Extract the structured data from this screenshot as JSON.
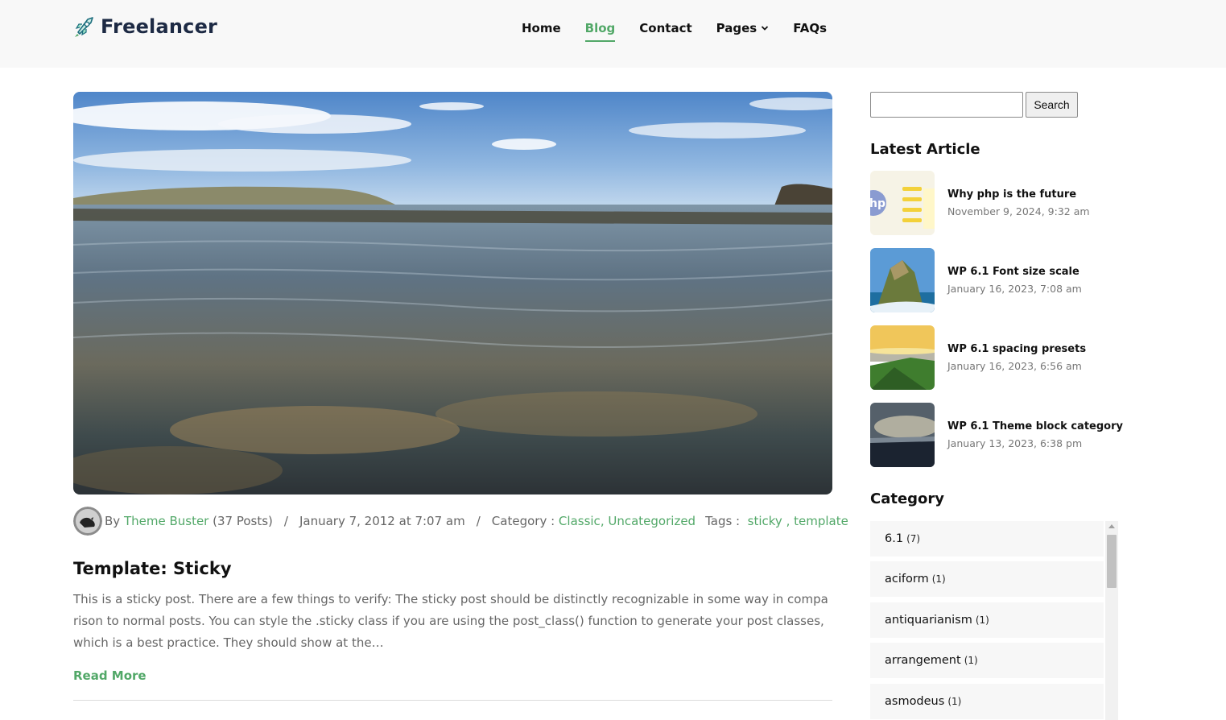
{
  "header": {
    "logo_text": "Freelancer",
    "nav": [
      {
        "label": "Home"
      },
      {
        "label": "Blog",
        "active": true
      },
      {
        "label": "Contact"
      },
      {
        "label": "Pages",
        "dropdown": true
      },
      {
        "label": "FAQs"
      }
    ]
  },
  "post": {
    "meta": {
      "by": "By",
      "author": "Theme Buster",
      "author_posts": "(37 Posts)",
      "sep": "/",
      "date": "January 7, 2012 at 7:07 am",
      "category_label": "Category :",
      "categories": [
        "Classic",
        "Uncategorized"
      ],
      "tags_label": "Tags :",
      "tags": [
        "sticky",
        "template"
      ]
    },
    "title": "Template: Sticky",
    "excerpt": "This is a sticky post. There are a few things to verify: The sticky post should be distinctly recognizable in some way in comparison to normal posts. You can style the .sticky class if you are using the post_class() function to generate your post classes, which is a best practice. They should show at the…",
    "read_more": "Read More"
  },
  "sidebar": {
    "search_button": "Search",
    "search_value": "",
    "latest_heading": "Latest Article",
    "articles": [
      {
        "title": "Why php is the future",
        "date": "November 9, 2024, 9:32 am"
      },
      {
        "title": "WP 6.1 Font size scale",
        "date": "January 16, 2023, 7:08 am"
      },
      {
        "title": "WP 6.1 spacing presets",
        "date": "January 16, 2023, 6:56 am"
      },
      {
        "title": "WP 6.1 Theme block category",
        "date": "January 13, 2023, 6:38 pm"
      }
    ],
    "category_heading": "Category",
    "categories": [
      {
        "name": "6.1",
        "count": "(7)"
      },
      {
        "name": "aciform",
        "count": "(1)"
      },
      {
        "name": "antiquarianism",
        "count": "(1)"
      },
      {
        "name": "arrangement",
        "count": "(1)"
      },
      {
        "name": "asmodeus",
        "count": "(1)"
      }
    ]
  },
  "colors": {
    "accent": "#52a868",
    "text": "#111111",
    "muted": "#666666"
  },
  "icons": [
    "rocket-logo-icon",
    "chevron-down-icon",
    "author-avatar"
  ]
}
